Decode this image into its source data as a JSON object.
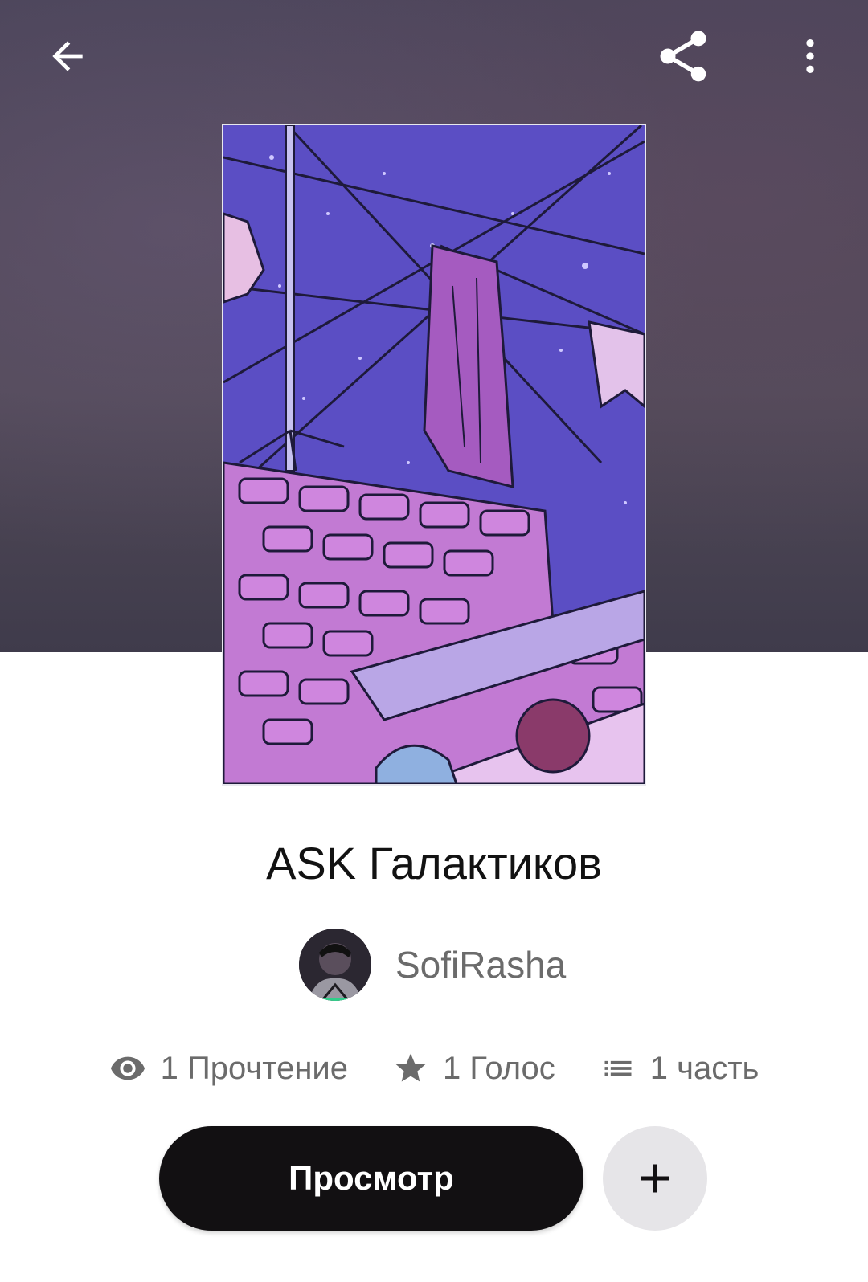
{
  "toolbar": {
    "back_icon": "arrow-left-icon",
    "share_icon": "share-icon",
    "more_icon": "more-vertical-icon"
  },
  "story": {
    "title": "ASK Галактиков",
    "author": "SofiRasha"
  },
  "stats": {
    "reads": "1 Прочтение",
    "votes": "1 Голос",
    "parts": "1 часть"
  },
  "actions": {
    "read_label": "Просмотр",
    "add_icon": "plus-icon"
  },
  "colors": {
    "hero_background": "#4a4458",
    "cover_sky": "#5e4fc2",
    "primary_button": "#121012",
    "secondary_button": "#e6e5e8",
    "muted_text": "#6b6b6b"
  }
}
